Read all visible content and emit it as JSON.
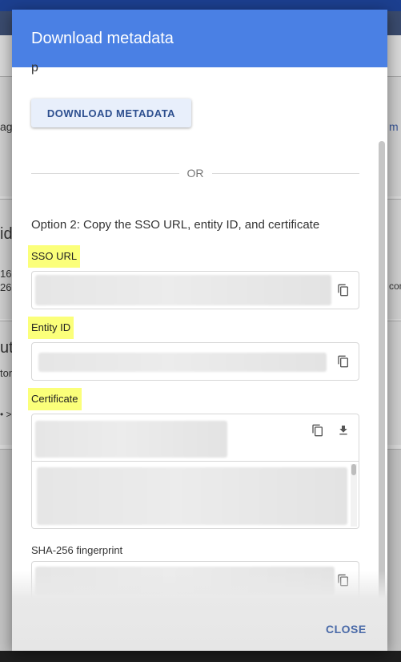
{
  "background": {
    "left_texts": [
      "ag",
      "id",
      "16",
      "26",
      "uto",
      "ton",
      "• >"
    ],
    "right_texts": [
      "m",
      "con"
    ]
  },
  "dialog": {
    "title": "Download metadata",
    "partial_text": "p",
    "download_button_label": "DOWNLOAD METADATA",
    "or_text": "OR",
    "option2_heading": "Option 2: Copy the SSO URL, entity ID, and certificate",
    "fields": {
      "sso_url": {
        "label": "SSO URL",
        "copy_icon": "copy-icon"
      },
      "entity_id": {
        "label": "Entity ID",
        "copy_icon": "copy-icon"
      },
      "certificate": {
        "label": "Certificate",
        "copy_icon": "copy-icon",
        "download_icon": "download-icon"
      },
      "sha256": {
        "label": "SHA-256 fingerprint",
        "copy_icon": "copy-icon"
      }
    },
    "close_label": "CLOSE"
  },
  "colors": {
    "header": "#4a80e4",
    "highlight": "#fbff7a",
    "button_text": "#2d4f8f",
    "close_text": "#4a6aa8"
  }
}
